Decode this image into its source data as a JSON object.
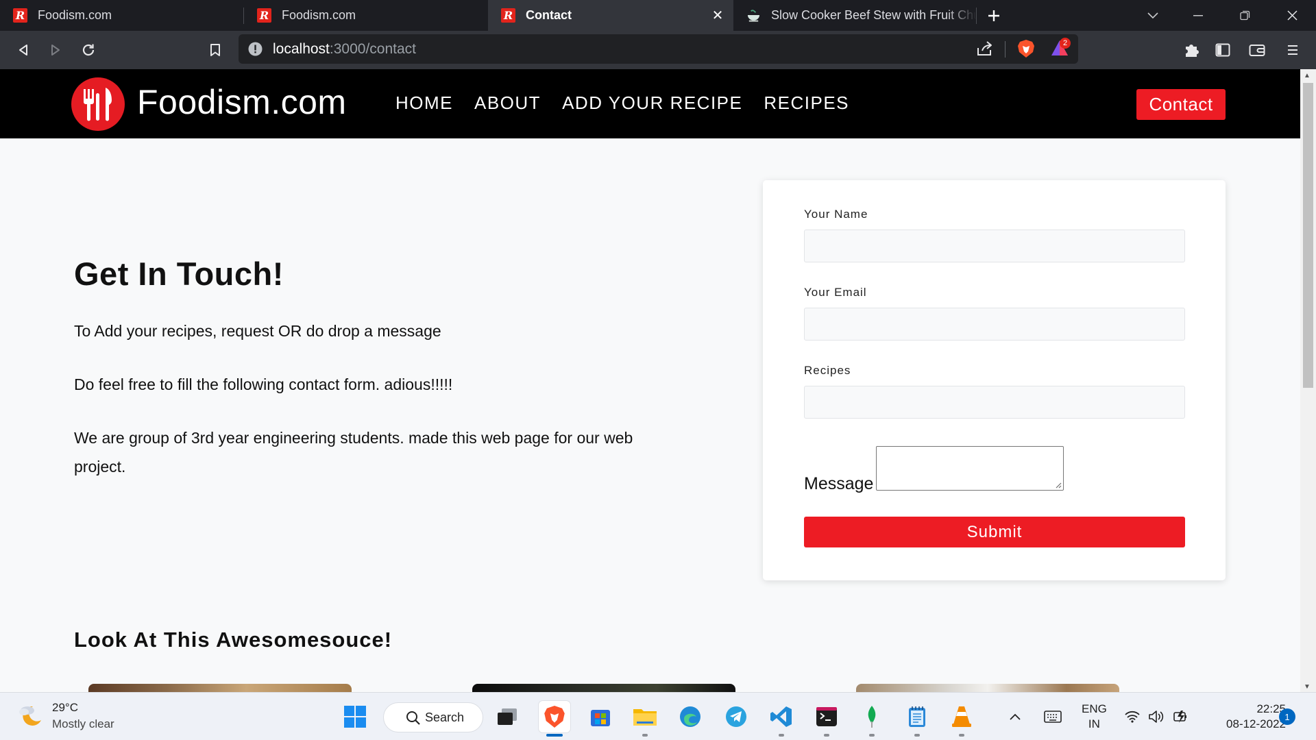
{
  "browser": {
    "tabs": [
      {
        "title": "Foodism.com",
        "favicon": "R",
        "active": false
      },
      {
        "title": "Foodism.com",
        "favicon": "R",
        "active": false
      },
      {
        "title": "Contact",
        "favicon": "R",
        "active": true
      },
      {
        "title": "Slow Cooker Beef Stew with Fruit Chutney",
        "favicon": "bowl-icon",
        "active": false
      }
    ],
    "url_host": "localhost",
    "url_path": ":3000/contact",
    "rewards_count": "2"
  },
  "site": {
    "brand": "Foodism.com",
    "nav": [
      "HOME",
      "ABOUT",
      "ADD YOUR RECIPE",
      "RECIPES"
    ],
    "contact_button": "Contact"
  },
  "content": {
    "heading": "Get In Touch!",
    "paragraphs": [
      "To Add your recipes, request OR do drop a message",
      "Do feel free to fill the following contact form. adious!!!!!",
      "We are group of 3rd year engineering students. made this web page for our web project."
    ],
    "section_title": "Look At This Awesomesouce!"
  },
  "form": {
    "name_label": "Your Name",
    "name_value": "",
    "email_label": "Your Email",
    "email_value": "",
    "recipes_label": "Recipes",
    "recipes_value": "",
    "message_label": "Message",
    "message_value": "",
    "submit_label": "Submit"
  },
  "taskbar": {
    "weather_temp": "29°C",
    "weather_desc": "Mostly clear",
    "search_label": "Search",
    "lang_line1": "ENG",
    "lang_line2": "IN",
    "time": "22:25",
    "date": "08-12-2022",
    "notification_count": "1"
  },
  "colors": {
    "brand_red": "#ed1c24",
    "nav_bg": "#000000",
    "page_bg": "#f8f9fa"
  }
}
